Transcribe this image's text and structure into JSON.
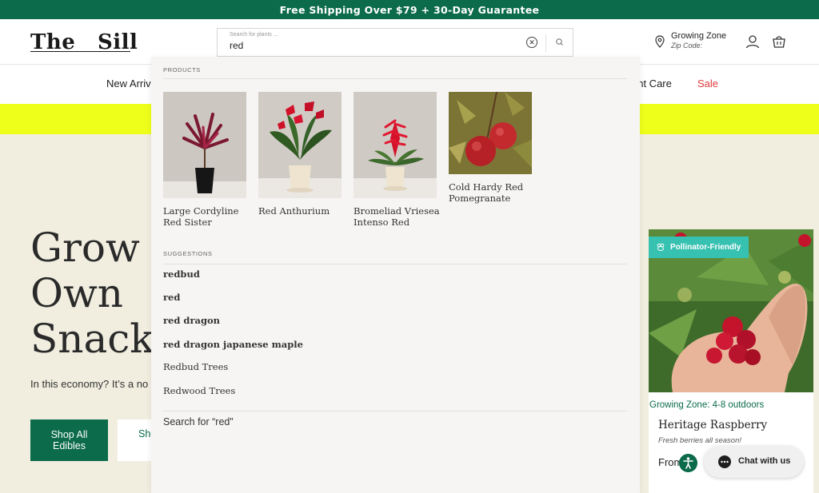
{
  "promo": {
    "text": "Free Shipping Over $79 + 30-Day Guarantee"
  },
  "header": {
    "logo_left": "The",
    "logo_right": "Sill",
    "search": {
      "placeholder": "Search for plants ...",
      "value": "red"
    },
    "growing_zone": {
      "title": "Growing Zone",
      "zip_label": "Zip Code:"
    }
  },
  "nav": {
    "new_arrivals_partial": "New Arriv",
    "plant_care_partial": "ant Care",
    "sale": "Sale"
  },
  "hero": {
    "title": "Grow Y\nOwn\nSnacks",
    "subtitle": "In this economy? It’s a no br",
    "primary_button": "Shop All Edibles",
    "secondary_button_partial": "Sho"
  },
  "dropdown": {
    "products_label": "PRODUCTS",
    "products": [
      {
        "name": "Large Cordyline Red Sister"
      },
      {
        "name": "Red Anthurium"
      },
      {
        "name": "Bromeliad Vriesea Intenso Red"
      },
      {
        "name": "Cold Hardy Red Pomegranate"
      }
    ],
    "suggestions_label": "SUGGESTIONS",
    "suggestions": [
      {
        "text": "redbud"
      },
      {
        "text": "red"
      },
      {
        "text": "red dragon"
      },
      {
        "text": "red dragon japanese maple"
      },
      {
        "text": "Redbud Trees"
      },
      {
        "text": "Redwood Trees"
      }
    ],
    "search_for": "Search for “red”"
  },
  "product_card": {
    "badge": "Pollinator-Friendly",
    "zone": "Growing Zone: 4-8 outdoors",
    "name": "Heritage Raspberry",
    "description": "Fresh berries all season!",
    "price_partial": "From"
  },
  "chat": {
    "label": "Chat with us"
  },
  "colors": {
    "brand_green": "#0b6b4a",
    "highlight_yellow": "#eeff1a",
    "sale_red": "#e03a3a",
    "badge_teal": "#36c1b0",
    "hero_bg": "#f1eee0"
  },
  "icons": {
    "search": "search-icon",
    "clear": "clear-icon",
    "location": "location-pin-icon",
    "account": "account-icon",
    "cart": "cart-icon",
    "bee": "bee-icon",
    "accessibility": "accessibility-icon",
    "chat": "chat-bubble-icon"
  }
}
